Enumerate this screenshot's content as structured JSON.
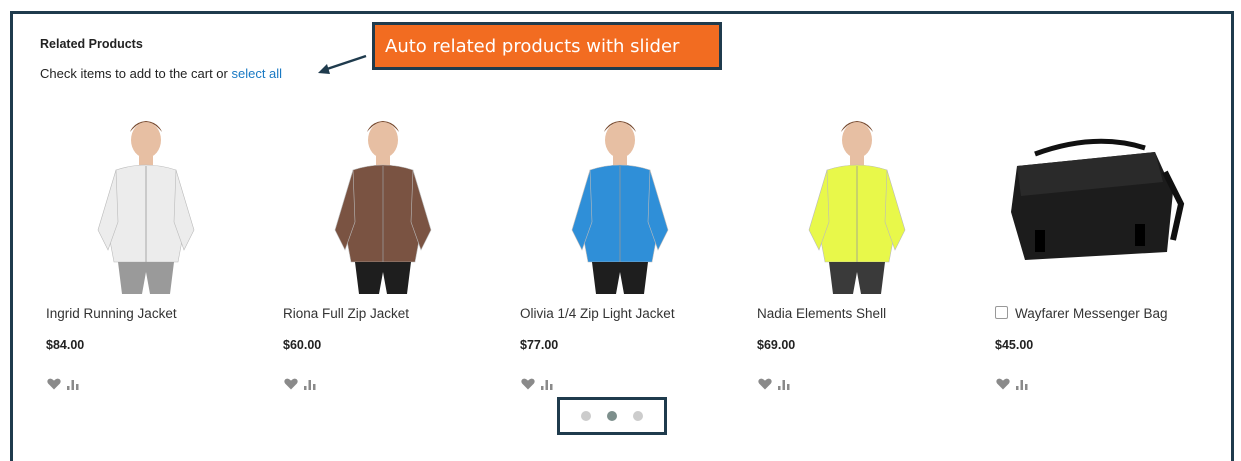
{
  "section": {
    "title": "Related Products",
    "instruction_prefix": "Check items to add to the cart or ",
    "select_all_label": "select all"
  },
  "callout": {
    "text": "Auto related products with slider"
  },
  "products": [
    {
      "name": "Ingrid Running Jacket",
      "price": "$84.00",
      "jacket_color": "#ececec",
      "pants_color": "#9a9a9a",
      "checkbox": false
    },
    {
      "name": "Riona Full Zip Jacket",
      "price": "$60.00",
      "jacket_color": "#7a5342",
      "pants_color": "#1e1e1e",
      "checkbox": false
    },
    {
      "name": "Olivia 1/4 Zip Light Jacket",
      "price": "$77.00",
      "jacket_color": "#2f8fd8",
      "pants_color": "#1e1e1e",
      "checkbox": false
    },
    {
      "name": "Nadia Elements Shell",
      "price": "$69.00",
      "jacket_color": "#e8f84a",
      "pants_color": "#3a3a3a",
      "checkbox": false
    },
    {
      "name": "Wayfarer Messenger Bag",
      "price": "$45.00",
      "checkbox": true
    }
  ],
  "actions": {
    "wishlist_icon": "heart-icon",
    "compare_icon": "bar-chart-icon"
  },
  "slider": {
    "pages": 3,
    "active_index": 1
  }
}
